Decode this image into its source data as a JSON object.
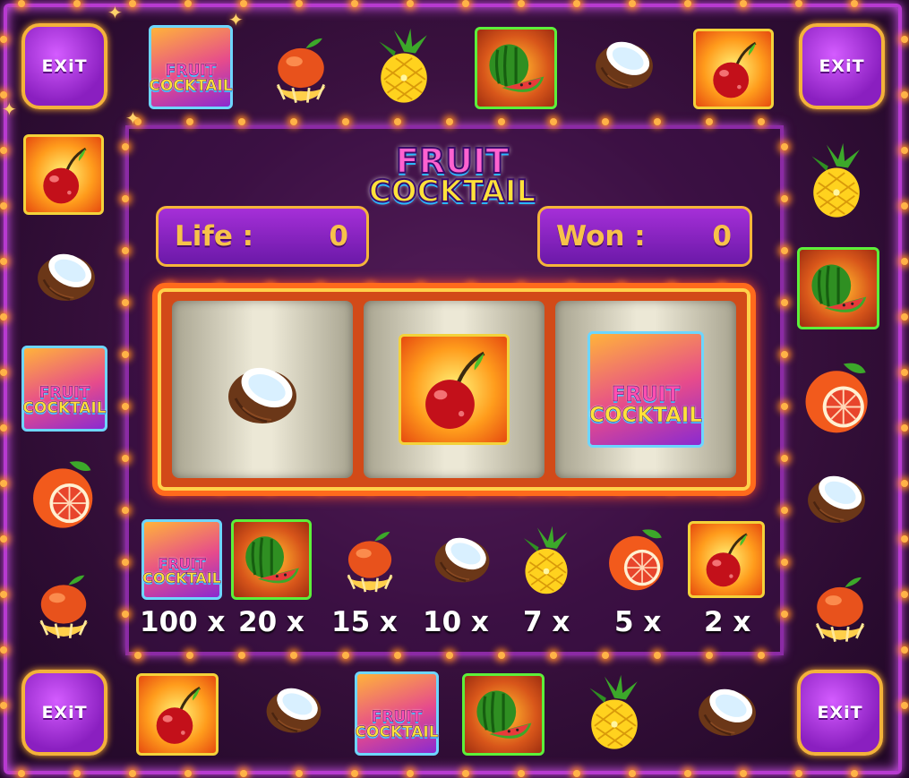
{
  "title": {
    "line1": "FRUIT",
    "line2": "COCKTAIL"
  },
  "logo_tile": {
    "line1": "FRUIT",
    "line2": "COCKTAIL"
  },
  "exit_label": "EXiT",
  "stats": {
    "life_label": "Life :",
    "life_value": "0",
    "won_label": "Won :",
    "won_value": "0"
  },
  "reels": [
    "coconut",
    "cherry",
    "fruit-cocktail-logo"
  ],
  "paytable": [
    "100 x",
    "20 x",
    "15 x",
    "10 x",
    "7 x",
    "5 x",
    "2 x"
  ],
  "colors": {
    "accent": "#b73ad0",
    "gold": "#f5b53a",
    "reel_frame": "#ff6a1c"
  }
}
